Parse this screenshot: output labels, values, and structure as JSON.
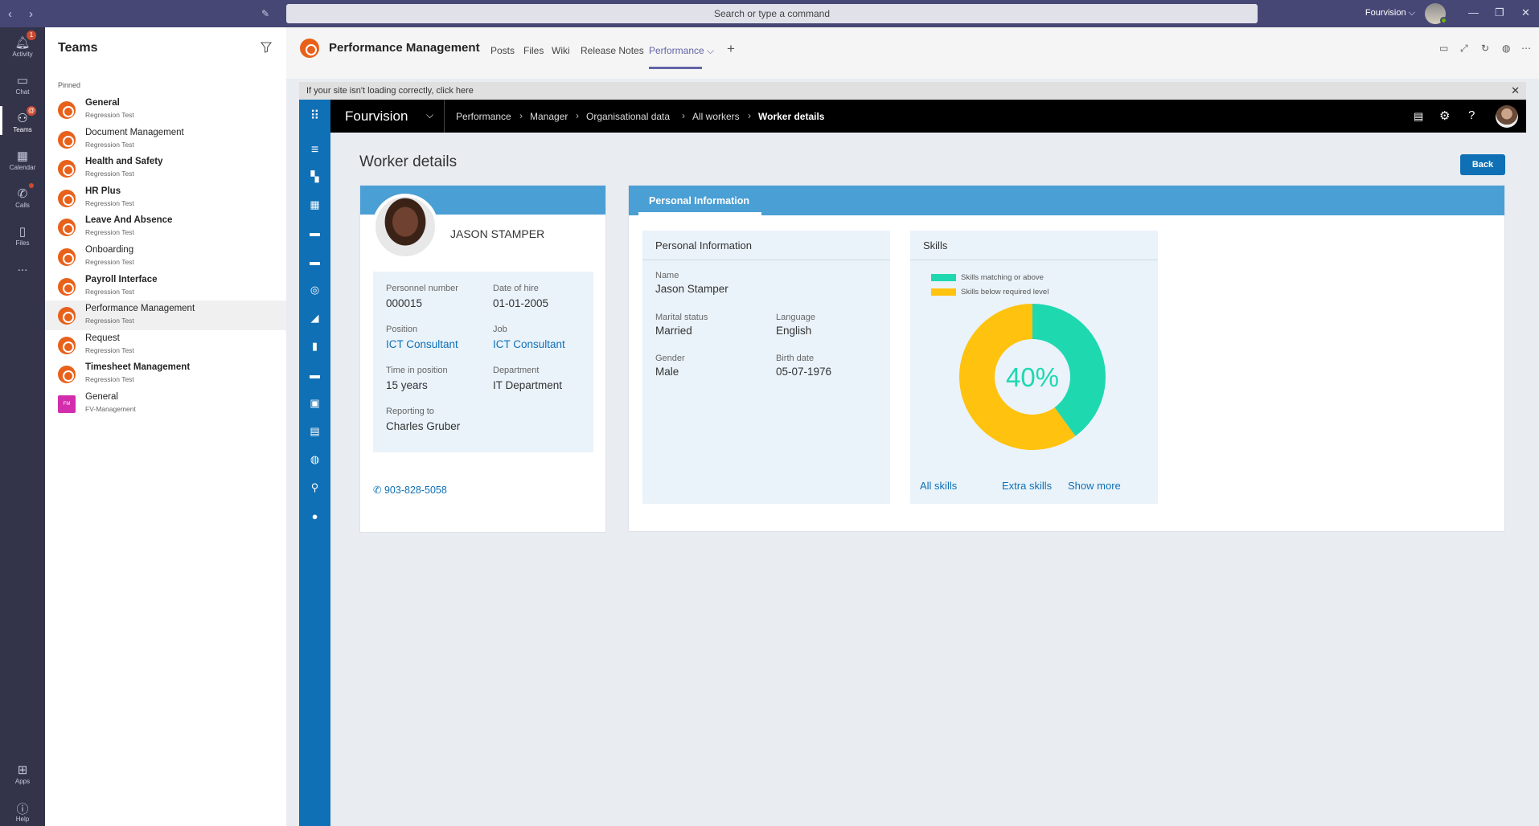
{
  "titlebar": {
    "search_placeholder": "Search or type a command",
    "org": "Fourvision ⌵"
  },
  "rail": {
    "items": [
      {
        "label": "Activity",
        "badge": "1"
      },
      {
        "label": "Chat"
      },
      {
        "label": "Teams",
        "badge": "@"
      },
      {
        "label": "Calendar"
      },
      {
        "label": "Calls"
      },
      {
        "label": "Files"
      },
      {
        "label": "..."
      },
      {
        "label": "Apps"
      },
      {
        "label": "Help"
      }
    ]
  },
  "teams": {
    "title": "Teams",
    "pinned_label": "Pinned",
    "list": [
      {
        "name": "General",
        "sub": "Regression Test"
      },
      {
        "name": "Document Management",
        "sub": "Regression Test"
      },
      {
        "name": "Health and Safety",
        "sub": "Regression Test"
      },
      {
        "name": "HR Plus",
        "sub": "Regression Test"
      },
      {
        "name": "Leave And Absence",
        "sub": "Regression Test"
      },
      {
        "name": "Onboarding",
        "sub": "Regression Test"
      },
      {
        "name": "Payroll Interface",
        "sub": "Regression Test"
      },
      {
        "name": "Performance Management",
        "sub": "Regression Test"
      },
      {
        "name": "Request",
        "sub": "Regression Test"
      },
      {
        "name": "Timesheet Management",
        "sub": "Regression Test"
      },
      {
        "name": "General",
        "sub": "FV-Management",
        "avatar_text": "FM"
      }
    ]
  },
  "header": {
    "title": "Performance Management",
    "tabs": [
      "Posts",
      "Files",
      "Wiki",
      "Release Notes",
      "Performance ⌵"
    ],
    "add": "+"
  },
  "notice": {
    "text": "If your site isn't loading correctly, click here"
  },
  "appbar": {
    "brand": "Fourvision",
    "breadcrumb": [
      "Performance",
      "Manager",
      "Organisational data",
      "All workers",
      "Worker details"
    ]
  },
  "page": {
    "title": "Worker details",
    "back_label": "Back"
  },
  "worker": {
    "name": "JASON STAMPER",
    "fields": {
      "personnel_number": {
        "label": "Personnel number",
        "value": "000015"
      },
      "date_of_hire": {
        "label": "Date of hire",
        "value": "01-01-2005"
      },
      "position": {
        "label": "Position",
        "value": "ICT Consultant"
      },
      "job": {
        "label": "Job",
        "value": "ICT Consultant"
      },
      "time_in_position": {
        "label": "Time in position",
        "value": "15 years"
      },
      "department": {
        "label": "Department",
        "value": "IT Department"
      },
      "reporting_to": {
        "label": "Reporting to",
        "value": "Charles Gruber"
      }
    },
    "phone": "903-828-5058"
  },
  "personal": {
    "tab": "Personal Information",
    "box_title": "Personal Information",
    "name": {
      "label": "Name",
      "value": "Jason Stamper"
    },
    "marital": {
      "label": "Marital status",
      "value": "Married"
    },
    "language": {
      "label": "Language",
      "value": "English"
    },
    "gender": {
      "label": "Gender",
      "value": "Male"
    },
    "birth": {
      "label": "Birth date",
      "value": "05-07-1976"
    }
  },
  "skills": {
    "title": "Skills",
    "legend_match": "Skills matching or above",
    "legend_below": "Skills below required level",
    "percent_label": "40%",
    "match_fraction": 0.4,
    "colors": {
      "match": "#1ed8b0",
      "below": "#ffc20e"
    },
    "links": [
      "All skills",
      "Extra skills",
      "Show more"
    ]
  }
}
